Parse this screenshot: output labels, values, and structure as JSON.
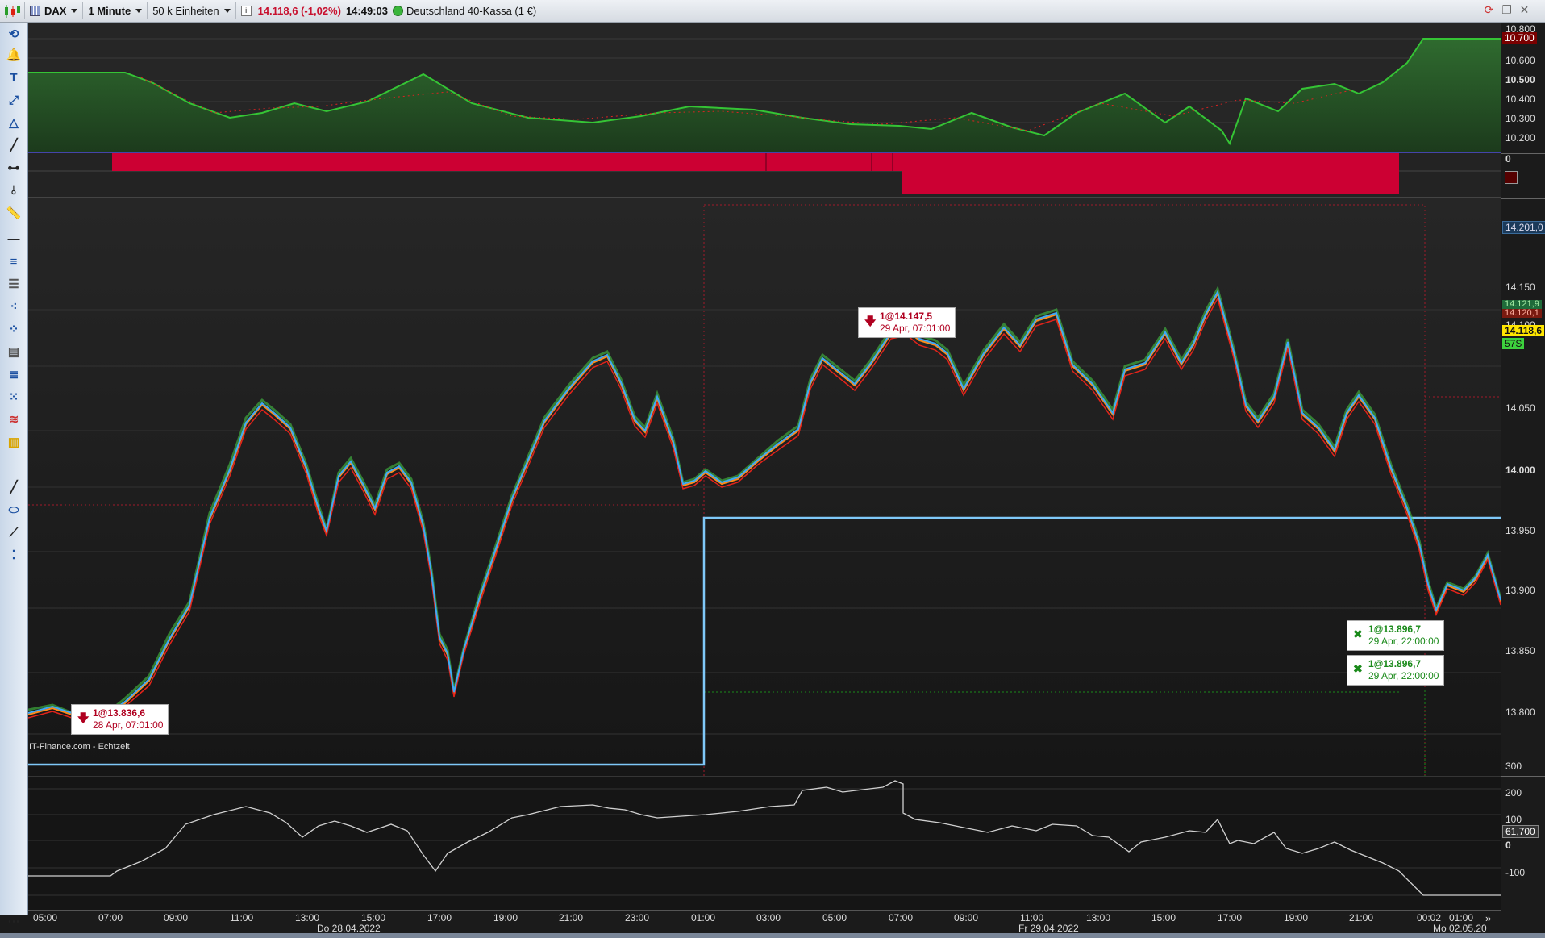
{
  "toolbar": {
    "symbol": "DAX",
    "interval": "1 Minute",
    "units": "50 k Einheiten",
    "price_change": "14.118,6 (-1,02%)",
    "time": "14:49:03",
    "instrument": "Deutschland 40-Kassa (1 €)"
  },
  "colors": {
    "price_line_blue": "#3fa9f5",
    "ma_orange": "#ff8c1a",
    "ma_red": "#e2231a",
    "candle_green": "#47d147",
    "position_line": "#7fc8f8",
    "flag_yellow": "#ffe600",
    "flag_green": "#3dd13d",
    "equity_green": "#1a9e1a",
    "signal_red": "#cc0033"
  },
  "top_panel": {
    "axis_labels": [
      "10.800",
      "10.700",
      "10.600",
      "10.500",
      "10.400",
      "10.300",
      "10.200"
    ]
  },
  "signal_panel": {
    "axis_labels": [
      "0"
    ]
  },
  "main_panel": {
    "axis_labels": [
      "14.201,0",
      "14.150",
      "14.100",
      "14.050",
      "14.000",
      "13.950",
      "13.900",
      "13.850",
      "13.800"
    ],
    "flags": {
      "f1": "14.121,9",
      "f2": "14.120,1",
      "f3": "14.118,6",
      "f4": "57S"
    },
    "source": "IT-Finance.com - Echtzeit",
    "trades": [
      {
        "label": "1@13.836,6",
        "time": "28 Apr, 07:01:00"
      },
      {
        "label": "1@14.147,5",
        "time": "29 Apr, 07:01:00"
      },
      {
        "label": "1@13.896,7",
        "time": "29 Apr, 22:00:00"
      },
      {
        "label": "1@13.896,7",
        "time": "29 Apr, 22:00:00"
      }
    ]
  },
  "osc_panel": {
    "axis_labels": [
      "300",
      "200",
      "100",
      "0",
      "-100"
    ],
    "flag": "61,700"
  },
  "x_axis": {
    "times": [
      "05:00",
      "07:00",
      "09:00",
      "11:00",
      "13:00",
      "15:00",
      "17:00",
      "19:00",
      "21:00",
      "23:00",
      "01:00",
      "03:00",
      "05:00",
      "07:00",
      "09:00",
      "11:00",
      "13:00",
      "15:00",
      "17:00",
      "19:00",
      "21:00",
      "00:02",
      "01:00"
    ],
    "dates": [
      "Do 28.04.2022",
      "Fr 29.04.2022",
      "Mo 02.05.20"
    ]
  }
}
